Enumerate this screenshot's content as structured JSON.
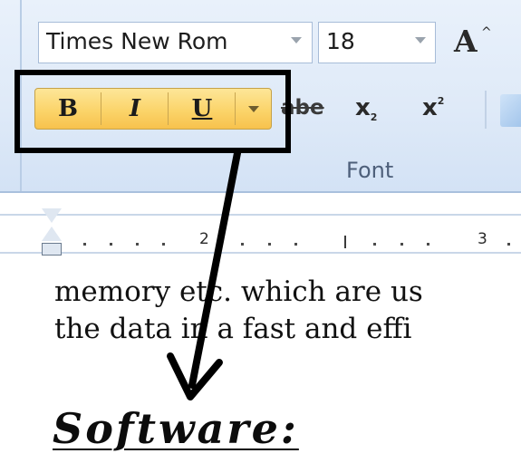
{
  "ribbon": {
    "font_name": "Times New Rom",
    "font_size": "18",
    "grow_font_glyph": "A",
    "grow_font_caret": "^",
    "bold_label": "B",
    "italic_label": "I",
    "underline_label": "U",
    "strikethrough_label": "abe",
    "subscript_label": "x",
    "subscript_mark": "2",
    "superscript_label": "x",
    "superscript_mark": "2",
    "group_label": "Font",
    "highlight_color": "#fbd46a",
    "icons": [
      "dropdown-arrow-icon",
      "grow-font-icon",
      "bold-icon",
      "italic-icon",
      "underline-icon",
      "underline-options-icon",
      "strikethrough-icon",
      "subscript-icon",
      "superscript-icon",
      "next-group-icon"
    ]
  },
  "ruler": {
    "numbers": [
      "2",
      "3"
    ]
  },
  "document": {
    "line1": "memory etc. which are us",
    "line2": "the data in a fast and effi",
    "heading": "Software:"
  }
}
